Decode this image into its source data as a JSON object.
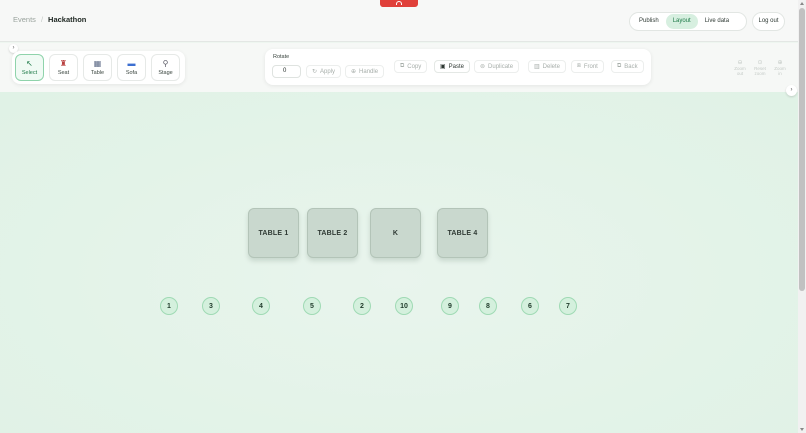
{
  "header": {
    "breadcrumb": {
      "parent": "Events",
      "separator": "/",
      "current": "Hackathon"
    },
    "nav_tabs": [
      {
        "label": "Publish",
        "active": false
      },
      {
        "label": "Layout",
        "active": true
      },
      {
        "label": "Live data",
        "active": false
      }
    ],
    "logout_label": "Log out"
  },
  "palette": {
    "tools": [
      {
        "label": "Select",
        "icon": "cursor-icon",
        "active": true
      },
      {
        "label": "Seat",
        "icon": "chair-icon",
        "active": false
      },
      {
        "label": "Table",
        "icon": "table-icon",
        "active": false
      },
      {
        "label": "Sofa",
        "icon": "sofa-icon",
        "active": false
      },
      {
        "label": "Stage",
        "icon": "microphone-icon",
        "active": false
      }
    ]
  },
  "toolbar": {
    "rotate_label": "Rotate",
    "rotate_value": "0",
    "apply_label": "Apply",
    "handle_label": "Handle",
    "copy_label": "Copy",
    "paste_label": "Paste",
    "duplicate_label": "Duplicate",
    "delete_label": "Delete",
    "front_label": "Front",
    "back_label": "Back"
  },
  "zoom": {
    "zoom_out_label": "Zoom out",
    "reset_label": "Reset zoom",
    "zoom_in_label": "Zoom in"
  },
  "canvas": {
    "tables": [
      "TABLE 1",
      "TABLE 2",
      "K",
      "TABLE 4"
    ],
    "seats": [
      "1",
      "3",
      "4",
      "5",
      "2",
      "10",
      "9",
      "8",
      "6",
      "7"
    ]
  },
  "colors": {
    "accent": "#1e7a48",
    "canvas_bg": "#e3f3e8",
    "table_fill": "#c9d8ce",
    "seat_fill": "#d4f0dd",
    "top_indicator": "#e0403a"
  }
}
